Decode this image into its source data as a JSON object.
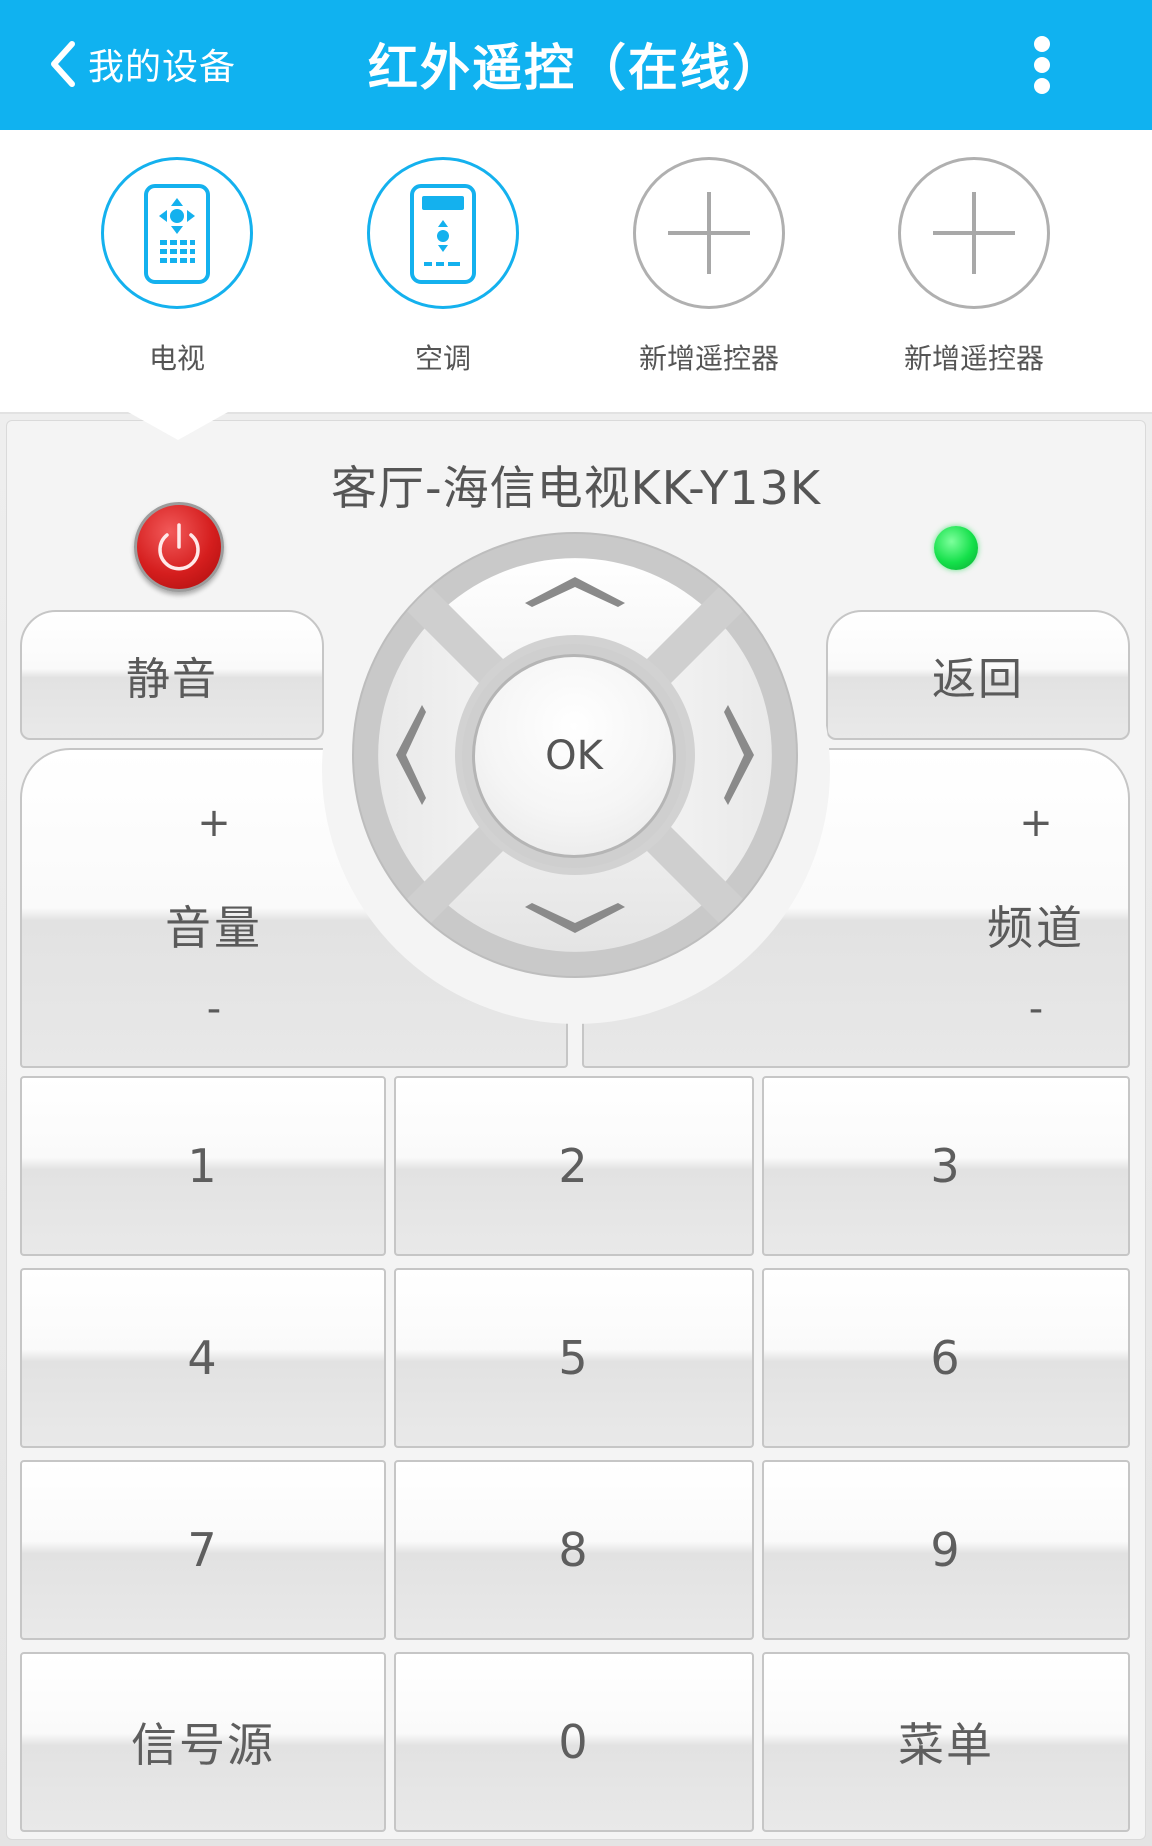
{
  "header": {
    "back_label": "我的设备",
    "title": "红外遥控（在线）",
    "accent_color": "#10b2f0"
  },
  "tabs": [
    {
      "label": "电视",
      "icon": "tv-remote-icon",
      "active": true
    },
    {
      "label": "空调",
      "icon": "ac-remote-icon",
      "active": false
    },
    {
      "label": "新增遥控器",
      "icon": "add-icon",
      "active": false
    },
    {
      "label": "新增遥控器",
      "icon": "add-icon",
      "active": false
    }
  ],
  "remote": {
    "device_name": "客厅-海信电视KK-Y13K",
    "status_led_color": "#14e04a",
    "mute_label": "静音",
    "back_label": "返回",
    "ok_label": "OK",
    "volume": {
      "plus": "+",
      "name": "音量",
      "minus": "-"
    },
    "channel": {
      "plus": "+",
      "name": "频道",
      "minus": "-"
    },
    "keys": [
      "1",
      "2",
      "3",
      "4",
      "5",
      "6",
      "7",
      "8",
      "9",
      "信号源",
      "0",
      "菜单"
    ]
  }
}
